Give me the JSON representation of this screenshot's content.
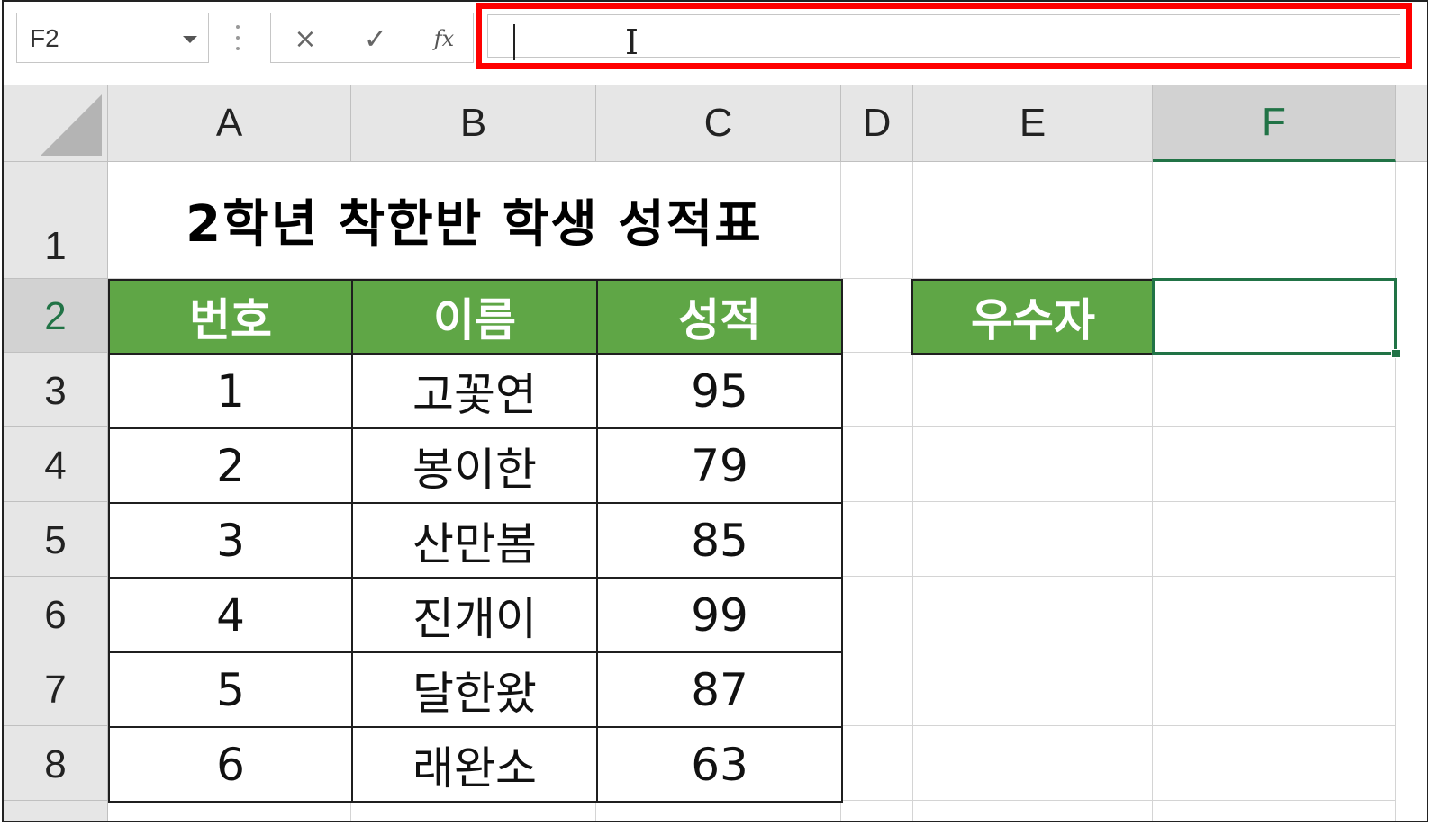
{
  "formula_bar": {
    "name_box": "F2",
    "cancel_icon": "×",
    "enter_icon": "✓",
    "fx_label": "fx",
    "formula_value": ""
  },
  "columns": [
    "A",
    "B",
    "C",
    "D",
    "E",
    "F"
  ],
  "rows": [
    "1",
    "2",
    "3",
    "4",
    "5",
    "6",
    "7",
    "8"
  ],
  "sheet": {
    "title": "2학년 착한반 학생 성적표",
    "headers": [
      "번호",
      "이름",
      "성적"
    ],
    "records": [
      {
        "no": "1",
        "name": "고꽃연",
        "score": "95"
      },
      {
        "no": "2",
        "name": "봉이한",
        "score": "79"
      },
      {
        "no": "3",
        "name": "산만봄",
        "score": "85"
      },
      {
        "no": "4",
        "name": "진개이",
        "score": "99"
      },
      {
        "no": "5",
        "name": "달한왔",
        "score": "87"
      },
      {
        "no": "6",
        "name": "래완소",
        "score": "63"
      }
    ],
    "top_label": "우수자",
    "top_value": ""
  },
  "colors": {
    "header_fill": "#5fa646",
    "selection": "#217346",
    "highlight": "#ff0000"
  }
}
